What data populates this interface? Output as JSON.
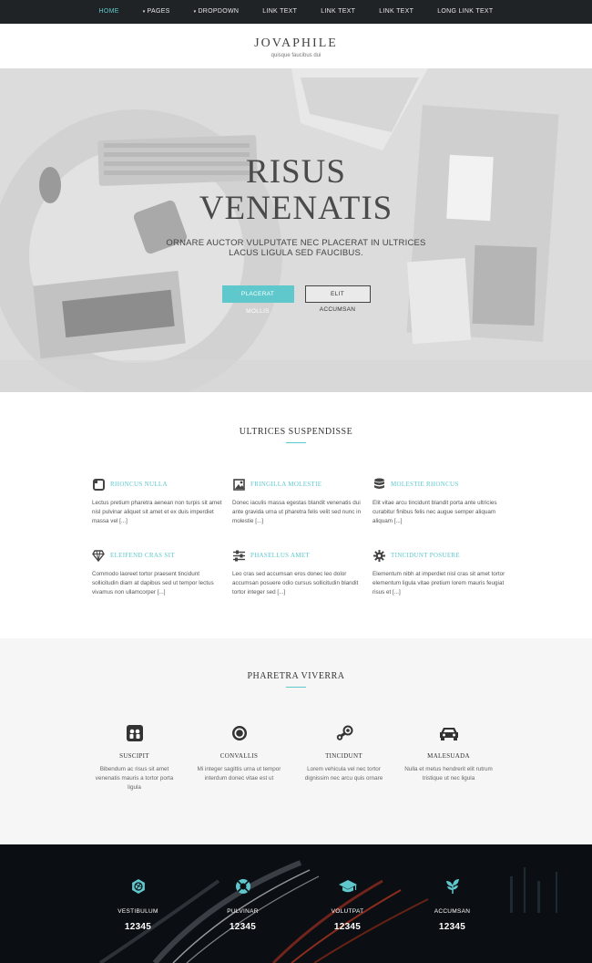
{
  "nav": {
    "items": [
      {
        "label": "HOME",
        "active": true,
        "caret": false
      },
      {
        "label": "PAGES",
        "active": false,
        "caret": true
      },
      {
        "label": "DROPDOWN",
        "active": false,
        "caret": true
      },
      {
        "label": "LINK TEXT",
        "active": false,
        "caret": false
      },
      {
        "label": "LINK TEXT",
        "active": false,
        "caret": false
      },
      {
        "label": "LINK TEXT",
        "active": false,
        "caret": false
      },
      {
        "label": "LONG LINK TEXT",
        "active": false,
        "caret": false
      }
    ],
    "caret_glyph": "▾"
  },
  "brand": {
    "logo": "JOVAPHILE",
    "tagline": "quisque faucibus dui"
  },
  "hero": {
    "title_line1": "RISUS",
    "title_line2": "VENENATIS",
    "subtitle": "ORNARE AUCTOR VULPUTATE NEC PLACERAT IN ULTRICES LACUS LIGULA SED FAUCIBUS.",
    "primary_button": "PLACERAT MOLLIS",
    "secondary_button": "ELIT ACCUMSAN"
  },
  "features": {
    "title": "ULTRICES SUSPENDISSE",
    "items": [
      {
        "icon": "square-icon",
        "title": "RHONCUS NULLA",
        "body": "Lectus pretium pharetra aenean non turpis sit amet nisl pulvinar aliquet sit amet et ex duis imperdiet massa vel [...]"
      },
      {
        "icon": "image-icon",
        "title": "FRINGILLA MOLESTIE",
        "body": "Donec iaculis massa egestas blandit venenatis dui ante gravida urna ut pharetra felis velit sed nunc in molestie [...]"
      },
      {
        "icon": "database-icon",
        "title": "MOLESTIE RHONCUS",
        "body": "Elit vitae arcu tincidunt blandit porta ante ultricies curabitur finibus felis nec augue semper aliquam aliquam [...]"
      },
      {
        "icon": "diamond-icon",
        "title": "ELEIFEND CRAS SIT",
        "body": "Commodo laoreet tortor praesent tincidunt sollicitudin diam at dapibus sed ut tempor lectus vivamus non ullamcorper [...]"
      },
      {
        "icon": "sliders-icon",
        "title": "PHASELLUS AMET",
        "body": "Leo cras sed accumsan eros donec leo dolor accumsan posuere odio cursus sollicitudin blandit tortor integer sed [...]"
      },
      {
        "icon": "gear-icon",
        "title": "TINCIDUNT POSUERE",
        "body": "Elementum nibh at imperdiet nisl cras sit amet tortor elementum ligula vitae pretium lorem mauris feugiat risus et [...]"
      }
    ]
  },
  "services": {
    "title": "PHARETRA VIVERRA",
    "items": [
      {
        "icon": "slideshare-icon",
        "title": "SUSCIPIT",
        "body": "Bibendum ac risus sit amet venenatis mauris a tortor porta ligula"
      },
      {
        "icon": "record-icon",
        "title": "CONVALLIS",
        "body": "Mi integer sagittis urna ut tempor interdum donec vitae est ut"
      },
      {
        "icon": "steam-icon",
        "title": "TINCIDUNT",
        "body": "Lorem vehicula vel nec tortor dignissim nec arcu quis ornare"
      },
      {
        "icon": "car-icon",
        "title": "MALESUADA",
        "body": "Nulla et metus hendrerit elit rutrum tristique ut nec ligula"
      }
    ]
  },
  "stats": {
    "items": [
      {
        "icon": "dribbble-icon",
        "label": "VESTIBULUM",
        "value": "12345"
      },
      {
        "icon": "lifebuoy-icon",
        "label": "PULVINAR",
        "value": "12345"
      },
      {
        "icon": "graduation-cap-icon",
        "label": "VOLUTPAT",
        "value": "12345"
      },
      {
        "icon": "leaf-icon",
        "label": "ACCUMSAN",
        "value": "12345"
      }
    ]
  },
  "colors": {
    "accent": "#5fc8cc",
    "nav_bg": "#1f2326",
    "footer_bg": "#0d1014"
  }
}
